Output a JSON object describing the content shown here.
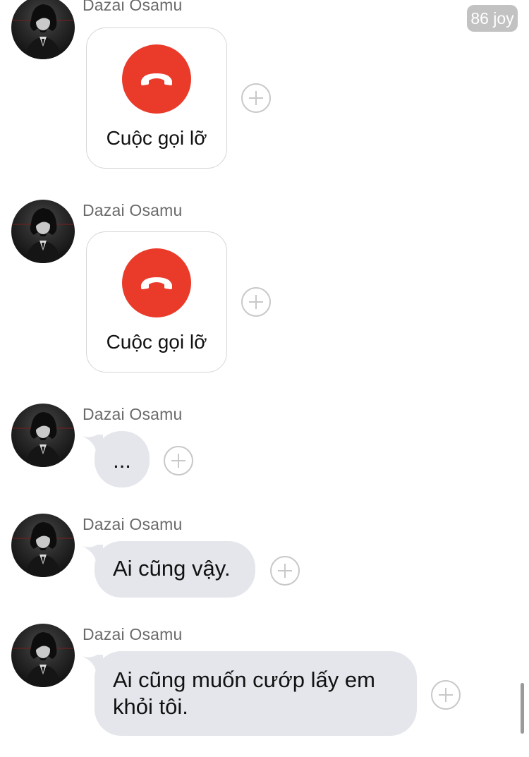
{
  "badge": {
    "text": "86 joy"
  },
  "messages": [
    {
      "sender": "Dazai Osamu",
      "call_label": "Cuộc gọi lỡ"
    },
    {
      "sender": "Dazai Osamu",
      "call_label": "Cuộc gọi lỡ"
    },
    {
      "sender": "Dazai Osamu",
      "text": "..."
    },
    {
      "sender": "Dazai Osamu",
      "text": "Ai cũng vậy."
    },
    {
      "sender": "Dazai Osamu",
      "text_line1": "Ai cũng muốn cướp lấy em",
      "text_line2": "khỏi tôi."
    }
  ],
  "colors": {
    "missed_call": "#ea3b2a",
    "bubble": "#e4e6eb",
    "sender_text": "#6a6a6a"
  },
  "icons": {
    "avatar": "avatar-icon",
    "missed_call": "phone-hangup-icon",
    "react": "plus-circle-icon"
  }
}
